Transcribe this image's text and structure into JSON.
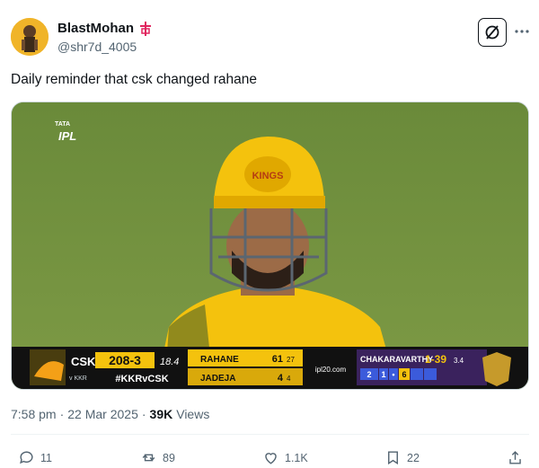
{
  "author": {
    "display_name": "BlastMohan",
    "handle": "@shr7d_4005",
    "badge_icon": "temple-flag-icon",
    "badge_color": "#e0245e"
  },
  "tweet": {
    "text": "Daily reminder that csk changed rahane"
  },
  "media": {
    "logo": "IPL",
    "logo_tagline": "TATA",
    "helmet_badge": "KINGS",
    "scoreboard": {
      "team": "CSK",
      "score": "208-3",
      "overs": "18.4",
      "versus": "v KKR",
      "hashtag": "#KKRvCSK",
      "batter1_name": "RAHANE",
      "batter1_runs": "61",
      "batter1_balls": "27",
      "batter2_name": "JADEJA",
      "batter2_runs": "4",
      "batter2_balls": "4",
      "sponsor": "ipl20.com",
      "bowler_name": "CHAKARAVARTHY",
      "bowler_figures": "1-39",
      "bowler_overs": "3.4",
      "balls": [
        "2",
        "1",
        "•",
        "6",
        "",
        ""
      ]
    }
  },
  "meta": {
    "time": "7:58 pm",
    "separator": "·",
    "date": "22 Mar 2025",
    "views_count": "39K",
    "views_label": "Views"
  },
  "actions": {
    "replies": "11",
    "reposts": "89",
    "likes": "1.1K",
    "bookmarks": "22"
  },
  "colors": {
    "csk_yellow": "#f4c20d",
    "kkr_purple": "#3a225d",
    "field_green": "#6f8b3d",
    "text_secondary": "#536471"
  }
}
